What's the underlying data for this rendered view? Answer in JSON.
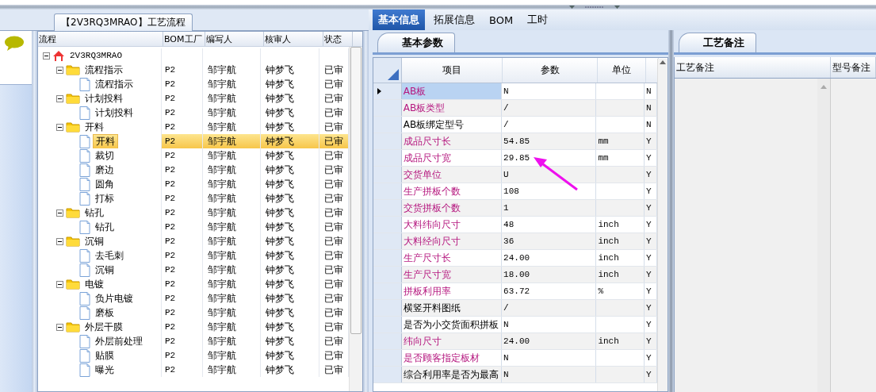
{
  "process_panel": {
    "title": "【2V3RQ3MRAO】工艺流程"
  },
  "tree_grid": {
    "columns": [
      "流程",
      "BOM工厂",
      "编写人",
      "核审人",
      "状态"
    ],
    "rows": [
      {
        "kind": "root",
        "name": "2V3RQ3MRAO",
        "expanded": true,
        "selected": false,
        "children": [
          {
            "kind": "folder",
            "name": "流程指示",
            "factory": "P2",
            "writer": "邹宇航",
            "reviewer": "钟梦飞",
            "status": "已审",
            "expanded": true,
            "selected": false,
            "children": [
              {
                "kind": "file",
                "name": "流程指示",
                "factory": "P2",
                "writer": "邹宇航",
                "reviewer": "钟梦飞",
                "status": "已审",
                "selected": false
              }
            ]
          },
          {
            "kind": "folder",
            "name": "计划投料",
            "factory": "P2",
            "writer": "邹宇航",
            "reviewer": "钟梦飞",
            "status": "已审",
            "expanded": true,
            "selected": false,
            "children": [
              {
                "kind": "file",
                "name": "计划投料",
                "factory": "P2",
                "writer": "邹宇航",
                "reviewer": "钟梦飞",
                "status": "已审",
                "selected": false
              }
            ]
          },
          {
            "kind": "folder",
            "name": "开料",
            "factory": "P2",
            "writer": "邹宇航",
            "reviewer": "钟梦飞",
            "status": "已审",
            "expanded": true,
            "selected": false,
            "children": [
              {
                "kind": "file",
                "name": "开料",
                "factory": "P2",
                "writer": "邹宇航",
                "reviewer": "钟梦飞",
                "status": "已审",
                "selected": true
              },
              {
                "kind": "file",
                "name": "裁切",
                "factory": "P2",
                "writer": "邹宇航",
                "reviewer": "钟梦飞",
                "status": "已审",
                "selected": false
              },
              {
                "kind": "file",
                "name": "磨边",
                "factory": "P2",
                "writer": "邹宇航",
                "reviewer": "钟梦飞",
                "status": "已审",
                "selected": false
              },
              {
                "kind": "file",
                "name": "圆角",
                "factory": "P2",
                "writer": "邹宇航",
                "reviewer": "钟梦飞",
                "status": "已审",
                "selected": false
              },
              {
                "kind": "file",
                "name": "打标",
                "factory": "P2",
                "writer": "邹宇航",
                "reviewer": "钟梦飞",
                "status": "已审",
                "selected": false
              }
            ]
          },
          {
            "kind": "folder",
            "name": "钻孔",
            "factory": "P2",
            "writer": "邹宇航",
            "reviewer": "钟梦飞",
            "status": "已审",
            "expanded": true,
            "selected": false,
            "children": [
              {
                "kind": "file",
                "name": "钻孔",
                "factory": "P2",
                "writer": "邹宇航",
                "reviewer": "钟梦飞",
                "status": "已审",
                "selected": false
              }
            ]
          },
          {
            "kind": "folder",
            "name": "沉铜",
            "factory": "P2",
            "writer": "邹宇航",
            "reviewer": "钟梦飞",
            "status": "已审",
            "expanded": true,
            "selected": false,
            "children": [
              {
                "kind": "file",
                "name": "去毛刺",
                "factory": "P2",
                "writer": "邹宇航",
                "reviewer": "钟梦飞",
                "status": "已审",
                "selected": false
              },
              {
                "kind": "file",
                "name": "沉铜",
                "factory": "P2",
                "writer": "邹宇航",
                "reviewer": "钟梦飞",
                "status": "已审",
                "selected": false
              }
            ]
          },
          {
            "kind": "folder",
            "name": "电镀",
            "factory": "P2",
            "writer": "邹宇航",
            "reviewer": "钟梦飞",
            "status": "已审",
            "expanded": true,
            "selected": false,
            "children": [
              {
                "kind": "file",
                "name": "负片电镀",
                "factory": "P2",
                "writer": "邹宇航",
                "reviewer": "钟梦飞",
                "status": "已审",
                "selected": false
              },
              {
                "kind": "file",
                "name": "磨板",
                "factory": "P2",
                "writer": "邹宇航",
                "reviewer": "钟梦飞",
                "status": "已审",
                "selected": false
              }
            ]
          },
          {
            "kind": "folder",
            "name": "外层干膜",
            "factory": "P2",
            "writer": "邹宇航",
            "reviewer": "钟梦飞",
            "status": "已审",
            "expanded": true,
            "selected": false,
            "children": [
              {
                "kind": "file",
                "name": "外层前处理",
                "factory": "P2",
                "writer": "邹宇航",
                "reviewer": "钟梦飞",
                "status": "已审",
                "selected": false
              },
              {
                "kind": "file",
                "name": "贴膜",
                "factory": "P2",
                "writer": "邹宇航",
                "reviewer": "钟梦飞",
                "status": "已审",
                "selected": false
              },
              {
                "kind": "file",
                "name": "曝光",
                "factory": "P2",
                "writer": "邹宇航",
                "reviewer": "钟梦飞",
                "status": "已审",
                "selected": false
              }
            ]
          }
        ]
      }
    ]
  },
  "tabs": [
    {
      "label": "基本信息",
      "selected": true
    },
    {
      "label": "拓展信息",
      "selected": false
    },
    {
      "label": "BOM",
      "selected": false
    },
    {
      "label": "工时",
      "selected": false
    }
  ],
  "parameters": {
    "tab": "基本参数",
    "columns": [
      "项目",
      "参数",
      "单位"
    ],
    "rows": [
      {
        "item": "AB板",
        "value": "N",
        "unit": "",
        "flag": "N",
        "required": true,
        "selected": true
      },
      {
        "item": "AB板类型",
        "value": "/",
        "unit": "",
        "flag": "N",
        "required": true,
        "selected": false
      },
      {
        "item": "AB板绑定型号",
        "value": "/",
        "unit": "",
        "flag": "N",
        "required": false,
        "selected": false
      },
      {
        "item": "成品尺寸长",
        "value": "54.85",
        "unit": "mm",
        "flag": "Y",
        "required": true,
        "selected": false
      },
      {
        "item": "成品尺寸宽",
        "value": "29.85",
        "unit": "mm",
        "flag": "Y",
        "required": true,
        "selected": false
      },
      {
        "item": "交货单位",
        "value": "U",
        "unit": "",
        "flag": "Y",
        "required": true,
        "selected": false
      },
      {
        "item": "生产拼板个数",
        "value": "108",
        "unit": "",
        "flag": "Y",
        "required": true,
        "selected": false
      },
      {
        "item": "交货拼板个数",
        "value": "1",
        "unit": "",
        "flag": "Y",
        "required": true,
        "selected": false
      },
      {
        "item": "大料纬向尺寸",
        "value": "48",
        "unit": "inch",
        "flag": "Y",
        "required": true,
        "selected": false
      },
      {
        "item": "大料经向尺寸",
        "value": "36",
        "unit": "inch",
        "flag": "Y",
        "required": true,
        "selected": false
      },
      {
        "item": "生产尺寸长",
        "value": "24.00",
        "unit": "inch",
        "flag": "Y",
        "required": true,
        "selected": false
      },
      {
        "item": "生产尺寸宽",
        "value": "18.00",
        "unit": "inch",
        "flag": "Y",
        "required": true,
        "selected": false
      },
      {
        "item": "拼板利用率",
        "value": "63.72",
        "unit": "%",
        "flag": "Y",
        "required": true,
        "selected": false
      },
      {
        "item": "横竖开料图纸",
        "value": "/",
        "unit": "",
        "flag": "Y",
        "required": false,
        "selected": false
      },
      {
        "item": "是否为小交货面积拼板",
        "value": "N",
        "unit": "",
        "flag": "Y",
        "required": false,
        "selected": false
      },
      {
        "item": "纬向尺寸",
        "value": "24.00",
        "unit": "inch",
        "flag": "Y",
        "required": true,
        "selected": false
      },
      {
        "item": "是否顾客指定板材",
        "value": "N",
        "unit": "",
        "flag": "Y",
        "required": true,
        "selected": false
      },
      {
        "item": "综合利用率是否为最高",
        "value": "N",
        "unit": "",
        "flag": "Y",
        "required": false,
        "selected": false
      }
    ]
  },
  "notes": {
    "tab": "工艺备注",
    "columns": [
      "工艺备注",
      "型号备注"
    ]
  }
}
